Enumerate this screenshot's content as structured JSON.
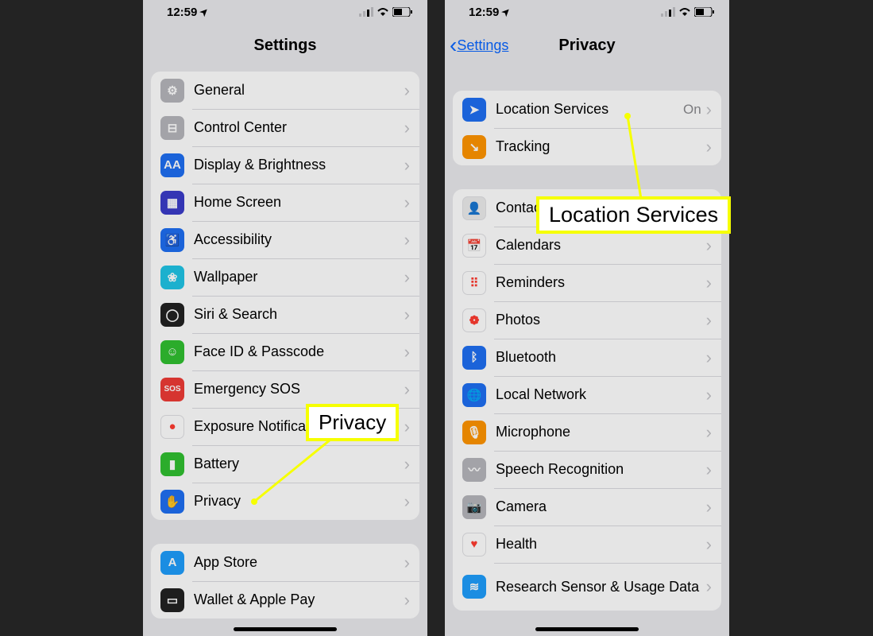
{
  "status": {
    "time": "12:59",
    "loc_arrow": "➤"
  },
  "left": {
    "nav_title": "Settings",
    "group1": [
      {
        "name": "general",
        "label": "General",
        "icon_bg": "#b6b6bb",
        "glyph": "⚙"
      },
      {
        "name": "control-center",
        "label": "Control Center",
        "icon_bg": "#b6b6bb",
        "glyph": "⊟"
      },
      {
        "name": "display-brightness",
        "label": "Display & Brightness",
        "icon_bg": "#1f6ff2",
        "glyph": "AA"
      },
      {
        "name": "home-screen",
        "label": "Home Screen",
        "icon_bg": "#3a3bc9",
        "glyph": "▦"
      },
      {
        "name": "accessibility",
        "label": "Accessibility",
        "icon_bg": "#1f6ff2",
        "glyph": "♿"
      },
      {
        "name": "wallpaper",
        "label": "Wallpaper",
        "icon_bg": "#20c4e6",
        "glyph": "❀"
      },
      {
        "name": "siri-search",
        "label": "Siri & Search",
        "icon_bg": "#222",
        "glyph": "◯"
      },
      {
        "name": "face-id",
        "label": "Face ID & Passcode",
        "icon_bg": "#30c030",
        "glyph": "☺"
      },
      {
        "name": "emergency-sos",
        "label": "Emergency SOS",
        "icon_bg": "#ef3b36",
        "glyph": "SOS"
      },
      {
        "name": "exposure-notifications",
        "label": "Exposure Notifications",
        "icon_bg": "#fff",
        "glyph": "●"
      },
      {
        "name": "battery",
        "label": "Battery",
        "icon_bg": "#30c030",
        "glyph": "▮"
      },
      {
        "name": "privacy",
        "label": "Privacy",
        "icon_bg": "#1f6ff2",
        "glyph": "✋"
      }
    ],
    "group2": [
      {
        "name": "app-store",
        "label": "App Store",
        "icon_bg": "#1f9efc",
        "glyph": "A"
      },
      {
        "name": "wallet-apple-pay",
        "label": "Wallet & Apple Pay",
        "icon_bg": "#222",
        "glyph": "▭"
      }
    ],
    "callout": "Privacy"
  },
  "right": {
    "nav_back": "Settings",
    "nav_title": "Privacy",
    "group1": [
      {
        "name": "location-services",
        "label": "Location Services",
        "value": "On",
        "icon_bg": "#1f6ff2",
        "glyph": "➤"
      },
      {
        "name": "tracking",
        "label": "Tracking",
        "icon_bg": "#ff9500",
        "glyph": "↘"
      }
    ],
    "group2": [
      {
        "name": "contacts",
        "label": "Contacts",
        "icon_bg": "#ececec",
        "glyph": "👤"
      },
      {
        "name": "calendars",
        "label": "Calendars",
        "icon_bg": "#fff",
        "glyph": "📅"
      },
      {
        "name": "reminders",
        "label": "Reminders",
        "icon_bg": "#fff",
        "glyph": "⠿"
      },
      {
        "name": "photos",
        "label": "Photos",
        "icon_bg": "#fff",
        "glyph": "❁"
      },
      {
        "name": "bluetooth",
        "label": "Bluetooth",
        "icon_bg": "#1f6ff2",
        "glyph": "ᛒ"
      },
      {
        "name": "local-network",
        "label": "Local Network",
        "icon_bg": "#1f6ff2",
        "glyph": "🌐"
      },
      {
        "name": "microphone",
        "label": "Microphone",
        "icon_bg": "#ff9500",
        "glyph": "🎙"
      },
      {
        "name": "speech-recognition",
        "label": "Speech Recognition",
        "icon_bg": "#b6b6bb",
        "glyph": "〰"
      },
      {
        "name": "camera",
        "label": "Camera",
        "icon_bg": "#b6b6bb",
        "glyph": "📷"
      },
      {
        "name": "health",
        "label": "Health",
        "icon_bg": "#fff",
        "glyph": "♥"
      },
      {
        "name": "research-sensor",
        "label": "Research Sensor & Usage Data",
        "icon_bg": "#1f9efc",
        "glyph": "≋",
        "tall": true
      }
    ],
    "callout": "Location Services"
  }
}
